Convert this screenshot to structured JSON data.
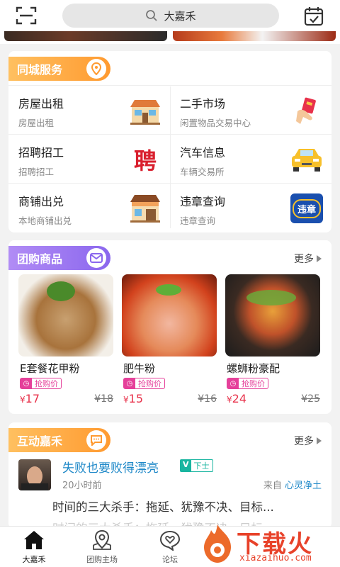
{
  "search": {
    "text": "大嘉禾"
  },
  "colors": {
    "orange": "#ffa23a",
    "purple": "#9c77f2",
    "pink": "#e5409a",
    "red": "#e8324b",
    "blue": "#1e88c8"
  },
  "services": {
    "title": "同城服务",
    "items": [
      {
        "title": "房屋出租",
        "sub": "房屋出租",
        "icon": "house-icon"
      },
      {
        "title": "二手市场",
        "sub": "闲置物品交易中心",
        "icon": "hand-card-icon"
      },
      {
        "title": "招聘招工",
        "sub": "招聘招工",
        "icon": "pin-badge-icon"
      },
      {
        "title": "汽车信息",
        "sub": "车辆交易所",
        "icon": "car-icon"
      },
      {
        "title": "商铺出兑",
        "sub": "本地商铺出兑",
        "icon": "shop-icon"
      },
      {
        "title": "违章查询",
        "sub": "违章查询",
        "icon": "violation-icon"
      }
    ],
    "badge_char": "聘",
    "violation_label": "违章"
  },
  "groupbuy": {
    "title": "团购商品",
    "more": "更多",
    "products": [
      {
        "name": "E套餐花甲粉",
        "tag": "抢购价",
        "price": "17",
        "old": "¥18"
      },
      {
        "name": "肥牛粉",
        "tag": "抢购价",
        "price": "15",
        "old": "¥16"
      },
      {
        "name": "螺蛳粉豪配",
        "tag": "抢购价",
        "price": "24",
        "old": "¥25"
      }
    ],
    "currency": "¥"
  },
  "interaction": {
    "title": "互动嘉禾",
    "more": "更多",
    "post": {
      "title": "失败也要败得漂亮",
      "badge_v": "V",
      "badge_text": "下士",
      "time": "20小时前",
      "from_prefix": "来自",
      "from_source": "心灵净土",
      "body": "时间的三大杀手：拖延、犹豫不决、目标...",
      "body_faded": "时间的三大杀手：拖延、犹豫不决、目标..."
    }
  },
  "nav": [
    {
      "label": "大嘉禾",
      "icon": "home-icon"
    },
    {
      "label": "团购主场",
      "icon": "location-icon"
    },
    {
      "label": "论坛",
      "icon": "chat-heart-icon"
    }
  ],
  "watermark": {
    "text": "下载火",
    "url": "xiazaihuo.com"
  }
}
